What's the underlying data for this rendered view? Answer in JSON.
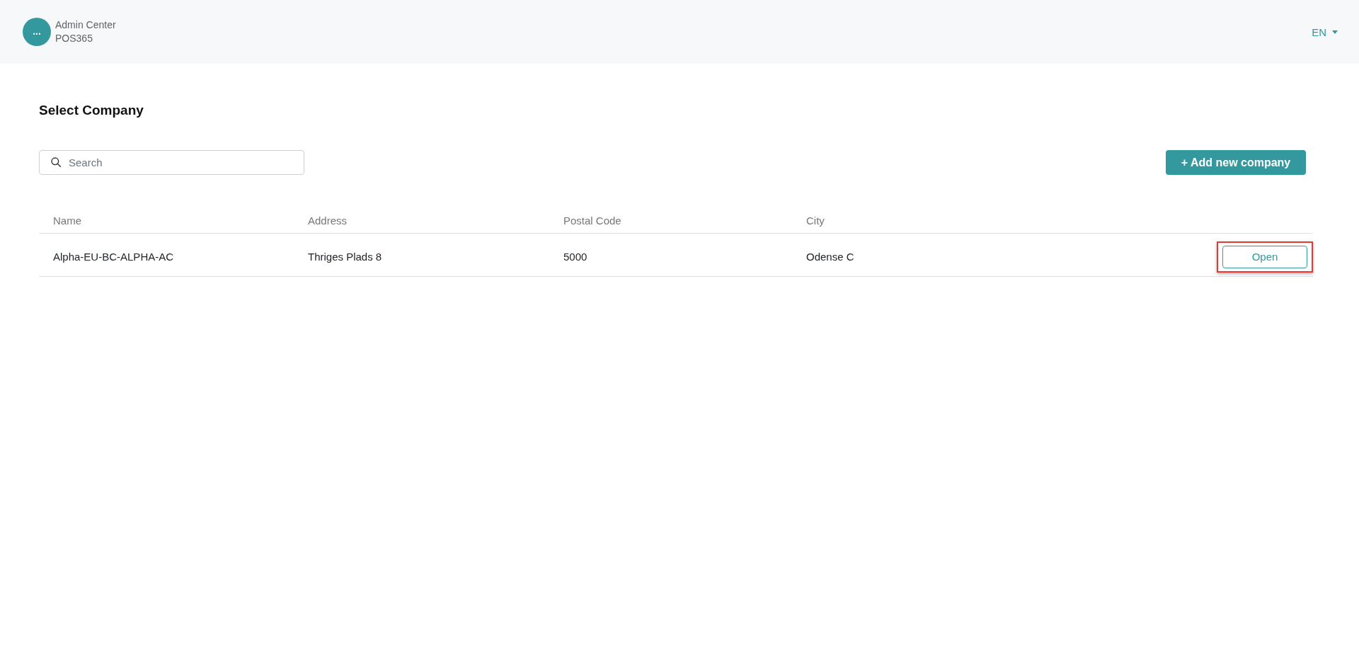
{
  "header": {
    "avatar": "...",
    "app_title": "Admin Center",
    "app_subtitle": "POS365",
    "language": "EN"
  },
  "page": {
    "title": "Select Company"
  },
  "search": {
    "placeholder": "Search"
  },
  "add_button": {
    "label": "+ Add new company"
  },
  "table": {
    "columns": [
      "Name",
      "Address",
      "Postal Code",
      "City"
    ],
    "rows": [
      {
        "cells": [
          "Alpha-EU-BC-ALPHA-AC",
          "Thriges Plads 8",
          "5000",
          "Odense C"
        ],
        "action": {
          "label": "Open",
          "highlighted": true
        }
      }
    ]
  }
}
